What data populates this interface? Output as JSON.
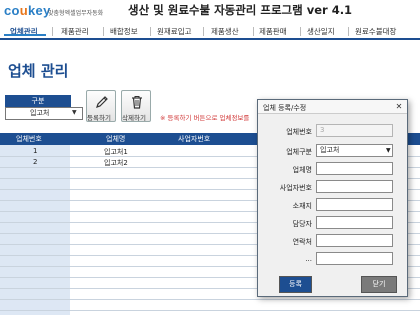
{
  "brand": {
    "logo_part1": "co",
    "logo_part2": "u",
    "logo_part3": "key",
    "tagline": "맞춤형엑셀업무자동화",
    "app_title": "생산 및 원료수불 자동관리 프로그램 ver 4.1"
  },
  "menu": {
    "items": [
      {
        "label": "업체관리",
        "active": true
      },
      {
        "label": "제품관리",
        "active": false
      },
      {
        "label": "배합정보",
        "active": false
      },
      {
        "label": "원재료입고",
        "active": false
      },
      {
        "label": "제품생산",
        "active": false
      },
      {
        "label": "제품판매",
        "active": false
      },
      {
        "label": "생산일지",
        "active": false
      },
      {
        "label": "원료수불대장",
        "active": false
      }
    ]
  },
  "page": {
    "title": "업체 관리"
  },
  "toolbar": {
    "category_label": "구분",
    "category_value": "입고처",
    "register_label": "등록하기",
    "delete_label": "삭제하기",
    "hint": "※ 등록하기 버튼으로 업체정보를"
  },
  "table": {
    "headers": [
      "업체번호",
      "업체명",
      "사업자번호"
    ],
    "rows": [
      {
        "no": "1",
        "name": "입고처1",
        "biz": ""
      },
      {
        "no": "2",
        "name": "입고처2",
        "biz": ""
      }
    ]
  },
  "dialog": {
    "title": "업체 등록/수정",
    "close_glyph": "✕",
    "fields": [
      {
        "label": "업체번호",
        "value": "3",
        "disabled": true
      },
      {
        "label": "업체구분",
        "value": "입고처",
        "dropdown": true
      },
      {
        "label": "업체명",
        "value": ""
      },
      {
        "label": "사업자번호",
        "value": ""
      },
      {
        "label": "소재지",
        "value": ""
      },
      {
        "label": "담당자",
        "value": ""
      },
      {
        "label": "연락처",
        "value": ""
      },
      {
        "label": "...",
        "value": ""
      }
    ],
    "register_button": "등록",
    "close_button": "닫기"
  },
  "colors": {
    "brand_blue": "#1d4e91",
    "logo_blue": "#2a7fc6",
    "logo_orange": "#e8761c",
    "hint_red": "#d23a3a",
    "close_gray": "#7a7a7a"
  },
  "icons": {
    "register": "pencil-icon",
    "delete": "trash-icon",
    "combo_arrow": "dropdown-arrow-icon",
    "dialog_close": "close-icon"
  }
}
